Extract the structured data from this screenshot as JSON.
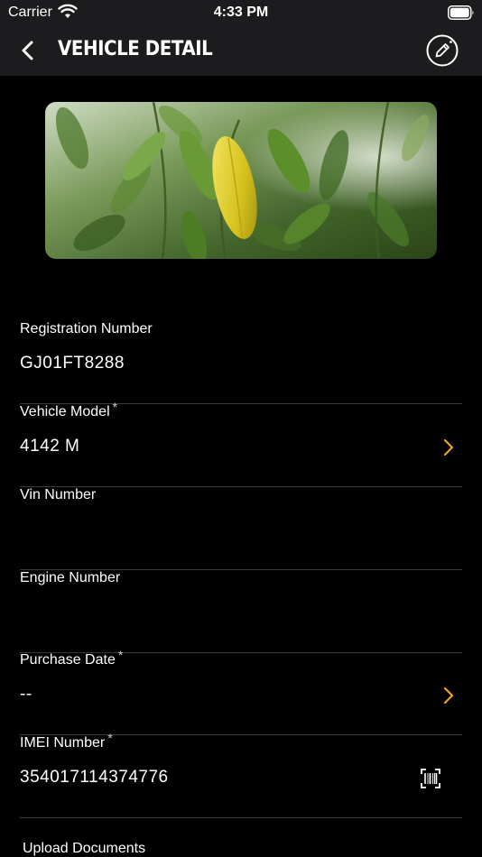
{
  "status_bar": {
    "carrier": "Carrier",
    "time": "4:33 PM"
  },
  "header": {
    "title": "VEHICLE DETAIL",
    "back_icon": "chevron-left-icon",
    "edit_icon": "pencil-circle-icon"
  },
  "hero_image": {
    "subject": "green leaves with a yellow leaf"
  },
  "fields": {
    "registration": {
      "label": "Registration Number",
      "required": false,
      "value": "GJ01FT8288"
    },
    "model": {
      "label": "Vehicle Model",
      "required_mark": "*",
      "value": "4142 M",
      "accessory": "chevron-right-icon"
    },
    "vin": {
      "label": "Vin Number",
      "value": ""
    },
    "engine": {
      "label": "Engine Number",
      "value": ""
    },
    "purchase_date": {
      "label": "Purchase Date",
      "required_mark": "*",
      "value": "--",
      "accessory": "chevron-right-icon"
    },
    "imei": {
      "label": "IMEI Number",
      "required_mark": "*",
      "value": "354017114374776",
      "accessory": "barcode-scan-icon"
    }
  },
  "upload": {
    "label": "Upload Documents"
  },
  "colors": {
    "background": "#000000",
    "bar_background": "#1c1c1e",
    "accent": "#f0a030",
    "divider": "#3a3a3c"
  }
}
